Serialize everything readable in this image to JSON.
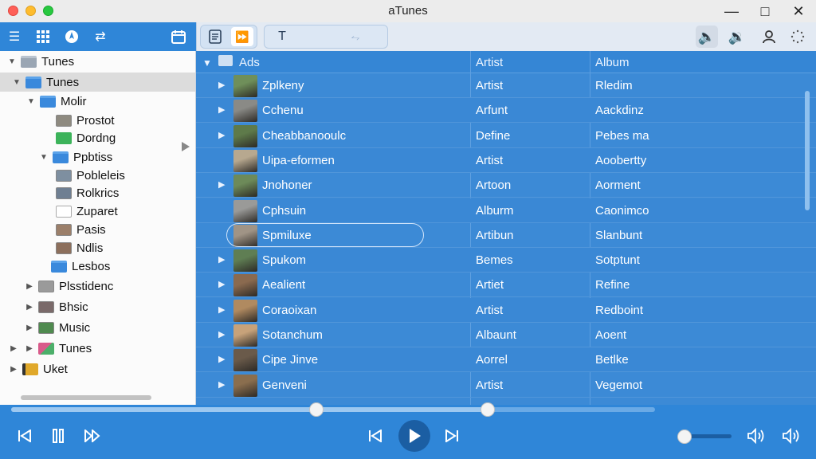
{
  "window": {
    "title": "aTunes"
  },
  "colors": {
    "accent": "#2f86d8",
    "list_bg": "#3c8ad6",
    "play_button": "#1b5ea3"
  },
  "toolbar": {
    "left_icons": [
      "menu-icon",
      "grid-icon",
      "compass-icon",
      "shuffle-icon",
      "calendar-icon"
    ],
    "seg1_icons": [
      "document-icon",
      "forward-icon"
    ],
    "seg2_icons": [
      "text-icon",
      "move-icon"
    ],
    "right_icons": [
      "volume-icon",
      "speaker-icon",
      "person-icon",
      "dots-icon"
    ],
    "text_label": "T"
  },
  "sidebar": {
    "items": [
      {
        "label": "Tunes",
        "depth": 0,
        "expanded": true,
        "icon": "folder-gray"
      },
      {
        "label": "Tunes",
        "depth": 1,
        "expanded": true,
        "icon": "folder",
        "selected": true
      },
      {
        "label": "Molir",
        "depth": 2,
        "expanded": true,
        "icon": "folder"
      },
      {
        "label": "Prostot",
        "depth": 3,
        "icon": "image"
      },
      {
        "label": "Dordng",
        "depth": 3,
        "icon": "image-green"
      },
      {
        "label": "Ppbtiss",
        "depth": 2,
        "expanded": true,
        "icon": "folder"
      },
      {
        "label": "Pobleleis",
        "depth": 3,
        "icon": "image"
      },
      {
        "label": "Rolkrics",
        "depth": 3,
        "icon": "image"
      },
      {
        "label": "Zuparet",
        "depth": 3,
        "icon": "blank"
      },
      {
        "label": "Pasis",
        "depth": 3,
        "icon": "image"
      },
      {
        "label": "Ndlis",
        "depth": 3,
        "icon": "image"
      },
      {
        "label": "Lesbos",
        "depth": 2,
        "icon": "folder"
      },
      {
        "label": "Plsstidenc",
        "depth": 1,
        "collapsed": true,
        "icon": "image"
      },
      {
        "label": "Bhsic",
        "depth": 1,
        "collapsed": true,
        "icon": "image"
      },
      {
        "label": "Music",
        "depth": 1,
        "collapsed": true,
        "icon": "image"
      },
      {
        "label": "Tunes",
        "depth": 1,
        "collapsed": true,
        "icon": "image"
      },
      {
        "label": "Uket",
        "depth": 0,
        "collapsed": true,
        "icon": "folder-gold"
      }
    ]
  },
  "list": {
    "columns": {
      "name": "Ads",
      "artist": "Artist",
      "album": "Album"
    },
    "rows": [
      {
        "name": "Zplkeny",
        "artist": "Artist",
        "album": "Rledim",
        "expand": true
      },
      {
        "name": "Cchenu",
        "artist": "Arfunt",
        "album": "Aackdinz",
        "expand": true
      },
      {
        "name": "Cheabbanooulc",
        "artist": "Define",
        "album": "Pebes ma",
        "expand": true
      },
      {
        "name": "Uipa-eformen",
        "artist": "Artist",
        "album": "Aoobertty",
        "expand": false
      },
      {
        "name": "Jnohoner",
        "artist": "Artoon",
        "album": "Aorment",
        "expand": true
      },
      {
        "name": "Cphsuin",
        "artist": "Alburm",
        "album": "Caonimco",
        "expand": false
      },
      {
        "name": "Spmiluxe",
        "artist": "Artibun",
        "album": "Slanbunt",
        "expand": false,
        "focused": true
      },
      {
        "name": "Spukom",
        "artist": "Bemes",
        "album": "Sotptunt",
        "expand": true
      },
      {
        "name": "Aealient",
        "artist": "Artiet",
        "album": "Refine",
        "expand": true
      },
      {
        "name": "Coraoixan",
        "artist": "Artist",
        "album": "Redboint",
        "expand": true
      },
      {
        "name": "Sotanchum",
        "artist": "Albaunt",
        "album": "Aoent",
        "expand": true
      },
      {
        "name": "Cipe Jinve",
        "artist": "Aorrel",
        "album": "Betlke",
        "expand": true
      },
      {
        "name": "Genveni",
        "artist": "Artist",
        "album": "Vegemot",
        "expand": true
      }
    ]
  },
  "player": {
    "progress_fraction": 0.74,
    "volume_fraction": 0.1,
    "controls": [
      "skip-back-icon",
      "pause-icon",
      "fast-forward-icon",
      "previous-icon",
      "play-icon",
      "next-icon",
      "volume-low-icon",
      "volume-high-icon"
    ]
  }
}
